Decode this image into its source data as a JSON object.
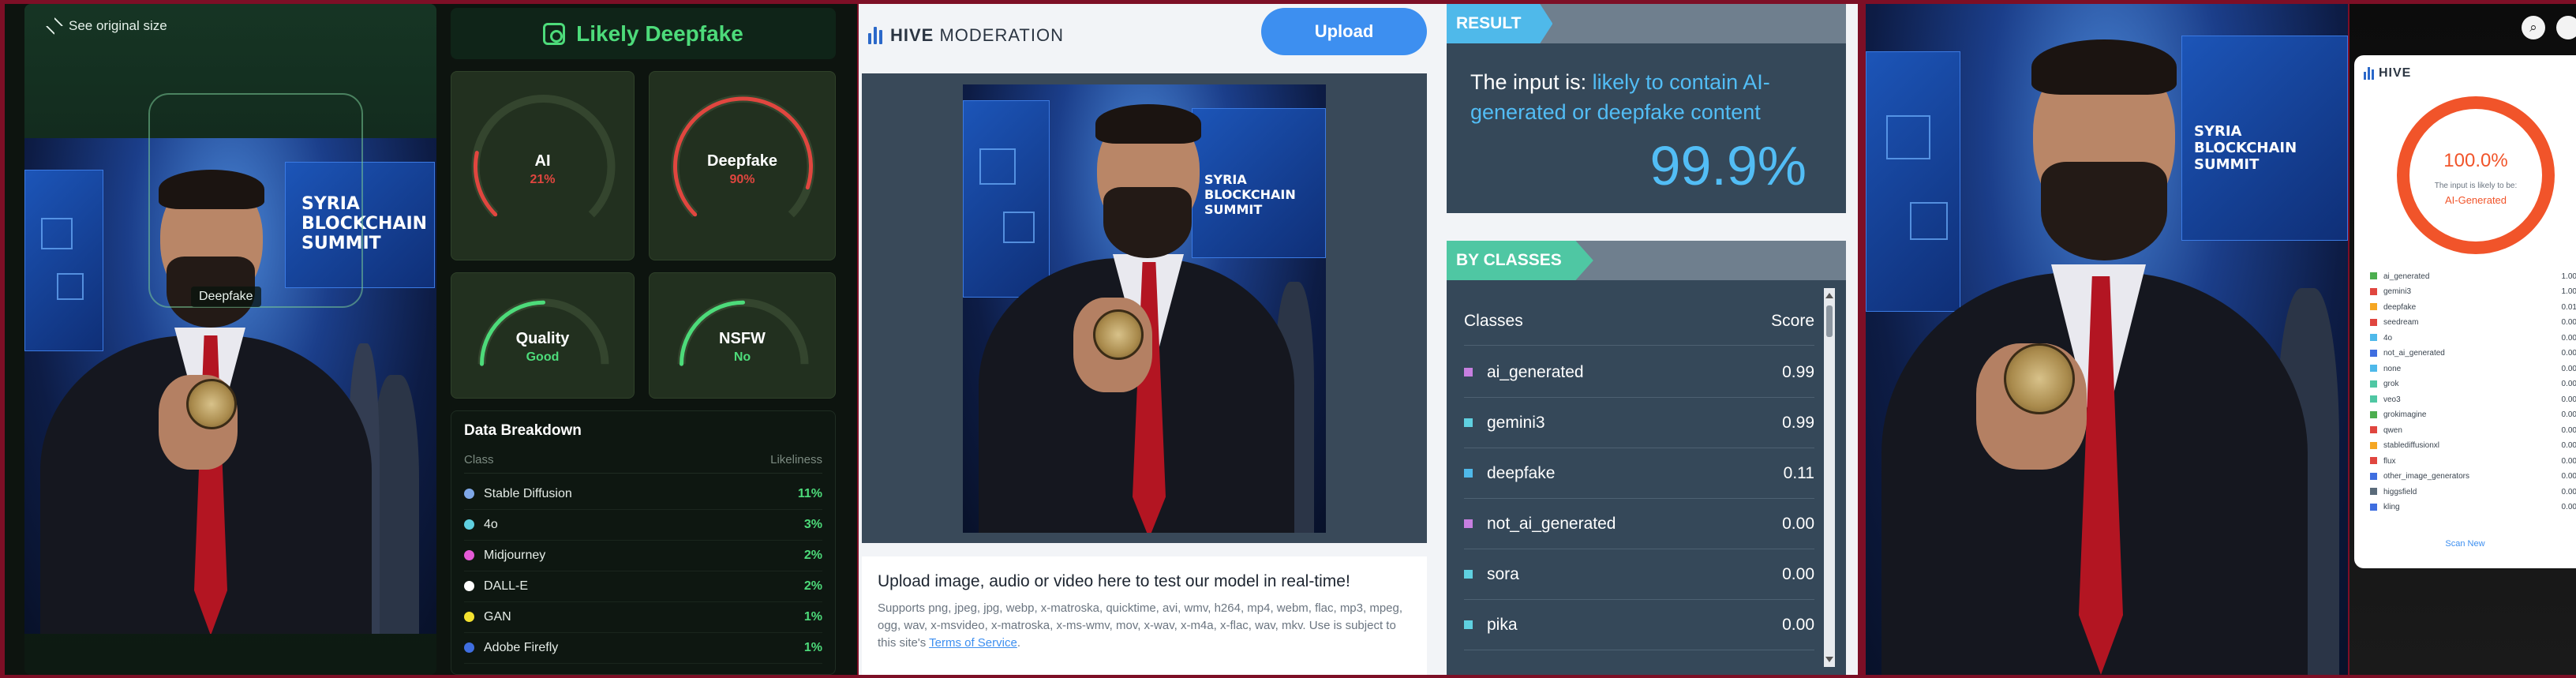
{
  "detector": {
    "see_original": "See original size",
    "face_tag": "Deepfake",
    "verdict": "Likely Deepfake",
    "gauges": [
      {
        "label": "AI",
        "value": "21%",
        "fraction": 0.21,
        "color": "#e0463f"
      },
      {
        "label": "Deepfake",
        "value": "90%",
        "fraction": 0.9,
        "color": "#e0463f"
      },
      {
        "label": "Quality",
        "value": "Good",
        "fraction": 0.5,
        "color": "#4ddb7a"
      },
      {
        "label": "NSFW",
        "value": "No",
        "fraction": 0.5,
        "color": "#4ddb7a"
      }
    ],
    "breakdown": {
      "title": "Data Breakdown",
      "col_class": "Class",
      "col_likeliness": "Likeliness",
      "rows": [
        {
          "name": "Stable Diffusion",
          "value": "11%",
          "color": "#7fa8e8"
        },
        {
          "name": "4o",
          "value": "3%",
          "color": "#5fd0e0"
        },
        {
          "name": "Midjourney",
          "value": "2%",
          "color": "#e55ad7"
        },
        {
          "name": "DALL-E",
          "value": "2%",
          "color": "#ffffff"
        },
        {
          "name": "GAN",
          "value": "1%",
          "color": "#f3e12f"
        },
        {
          "name": "Adobe Firefly",
          "value": "1%",
          "color": "#3f6ee0"
        }
      ]
    }
  },
  "hive": {
    "logo_bold": "HIVE",
    "logo_light": "MODERATION",
    "upload_label": "Upload",
    "upload_title": "Upload image, audio or video here to test our model in real-time!",
    "upload_desc": "Supports png, jpeg, jpg, webp, x-matroska, quicktime, avi, wmv, h264, mp4, webm, flac, mp3, mpeg, ogg, wav, x-msvideo, x-matroska, x-ms-wmv, mov, x-wav, x-m4a, x-flac, wav, mkv. Use is subject to this site's",
    "terms_link": "Terms of Service",
    "result_tag": "RESULT",
    "result_prefix": "The input is:",
    "result_highlight": "likely to contain AI-generated or deepfake content",
    "result_pct": "99.9%",
    "classes_tag": "BY CLASSES",
    "col_classes": "Classes",
    "col_score": "Score",
    "classes": [
      {
        "name": "ai_generated",
        "score": "0.99",
        "color": "#c77fe0"
      },
      {
        "name": "gemini3",
        "score": "0.99",
        "color": "#5fd0e0"
      },
      {
        "name": "deepfake",
        "score": "0.11",
        "color": "#4fb9ea"
      },
      {
        "name": "not_ai_generated",
        "score": "0.00",
        "color": "#c77fe0"
      },
      {
        "name": "sora",
        "score": "0.00",
        "color": "#5fd0e0"
      },
      {
        "name": "pika",
        "score": "0.00",
        "color": "#5fd0e0"
      }
    ]
  },
  "extension": {
    "logo": "HIVE",
    "percent": "100.0%",
    "subtitle": "The input is likely to be:",
    "label": "AI-Generated",
    "scan_new": "Scan New",
    "rows": [
      {
        "name": "ai_generated",
        "score": "1.00",
        "color": "#4cae4f"
      },
      {
        "name": "gemini3",
        "score": "1.00",
        "color": "#e0463f"
      },
      {
        "name": "deepfake",
        "score": "0.01",
        "color": "#f5a623"
      },
      {
        "name": "seedream",
        "score": "0.00",
        "color": "#e0463f"
      },
      {
        "name": "4o",
        "score": "0.00",
        "color": "#4fb9ea"
      },
      {
        "name": "not_ai_generated",
        "score": "0.00",
        "color": "#3f6ee0"
      },
      {
        "name": "none",
        "score": "0.00",
        "color": "#4fb9ea"
      },
      {
        "name": "grok",
        "score": "0.00",
        "color": "#4fc7a3"
      },
      {
        "name": "veo3",
        "score": "0.00",
        "color": "#4fc7a3"
      },
      {
        "name": "grokimagine",
        "score": "0.00",
        "color": "#4cae4f"
      },
      {
        "name": "qwen",
        "score": "0.00",
        "color": "#e0463f"
      },
      {
        "name": "stablediffusionxl",
        "score": "0.00",
        "color": "#f5a623"
      },
      {
        "name": "flux",
        "score": "0.00",
        "color": "#e0463f"
      },
      {
        "name": "other_image_generators",
        "score": "0.00",
        "color": "#3f6ee0"
      },
      {
        "name": "higgsfield",
        "score": "0.00",
        "color": "#5a6b7a"
      },
      {
        "name": "kling",
        "score": "0.00",
        "color": "#3f6ee0"
      }
    ]
  }
}
